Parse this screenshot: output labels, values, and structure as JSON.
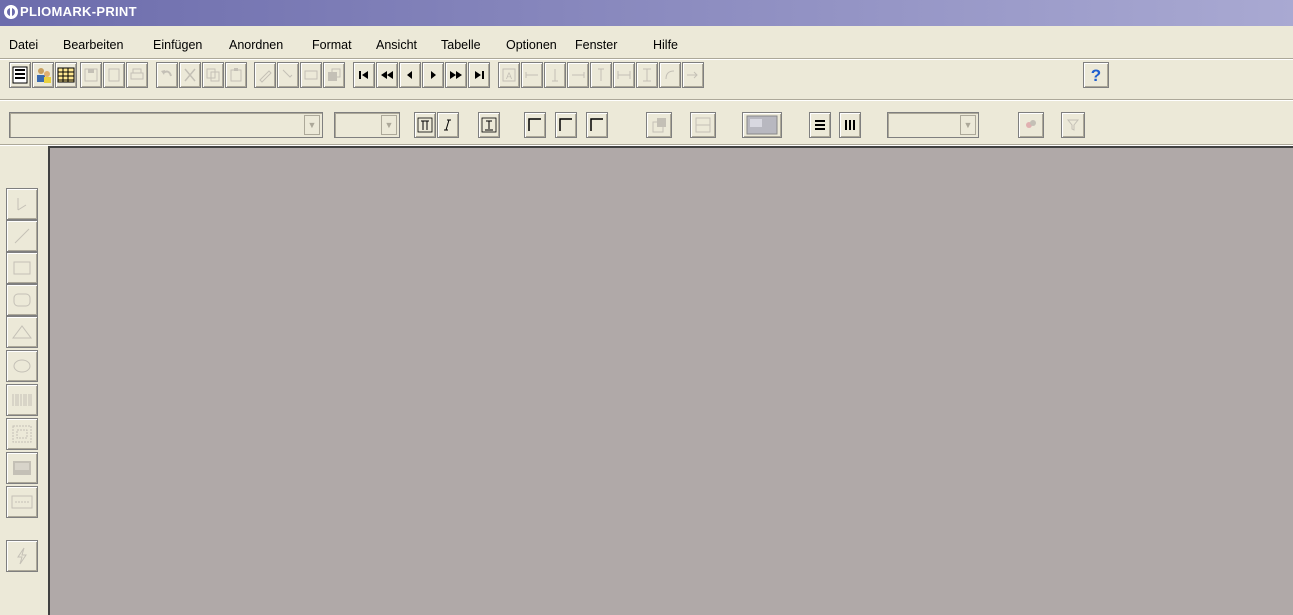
{
  "window": {
    "title": "PLIOMARK-PRINT",
    "title_bg": "#6c6cac",
    "app_icon": "scs-logo-icon"
  },
  "menu": {
    "items": [
      "Datei",
      "Bearbeiten",
      "Einfügen",
      "Anordnen",
      "Format",
      "Ansicht",
      "Tabelle",
      "Optionen",
      "Fenster",
      "Hilfe"
    ]
  },
  "toolbar1": {
    "buttons": [
      {
        "name": "list-view-icon",
        "enabled": true
      },
      {
        "name": "users-icon",
        "enabled": true
      },
      {
        "name": "table-grid-icon",
        "enabled": true
      },
      {
        "name": "save-icon",
        "enabled": false
      },
      {
        "name": "print-preview-icon",
        "enabled": false
      },
      {
        "name": "print-icon",
        "enabled": false
      },
      {
        "name": "undo-icon",
        "enabled": false
      },
      {
        "name": "cut-icon",
        "enabled": false
      },
      {
        "name": "copy-icon",
        "enabled": false
      },
      {
        "name": "paste-icon",
        "enabled": false
      },
      {
        "name": "pen-icon",
        "enabled": false
      },
      {
        "name": "pen-select-icon",
        "enabled": false
      },
      {
        "name": "text-field-icon",
        "enabled": false
      },
      {
        "name": "stack-icon",
        "enabled": false
      },
      {
        "name": "first-record-icon",
        "enabled": true
      },
      {
        "name": "fast-back-icon",
        "enabled": true
      },
      {
        "name": "prev-icon",
        "enabled": true
      },
      {
        "name": "next-icon",
        "enabled": true
      },
      {
        "name": "fast-forward-icon",
        "enabled": true
      },
      {
        "name": "last-record-icon",
        "enabled": true
      },
      {
        "name": "text-frame-icon",
        "enabled": false
      },
      {
        "name": "align-left-edge-icon",
        "enabled": false
      },
      {
        "name": "align-bottom-edge-icon",
        "enabled": false
      },
      {
        "name": "align-right-edge-icon",
        "enabled": false
      },
      {
        "name": "align-top-edge-icon",
        "enabled": false
      },
      {
        "name": "distribute-h-icon",
        "enabled": false
      },
      {
        "name": "distribute-v-icon",
        "enabled": false
      },
      {
        "name": "rotate-icon",
        "enabled": false
      },
      {
        "name": "import-icon",
        "enabled": false
      },
      {
        "name": "help-icon",
        "enabled": true
      }
    ]
  },
  "toolbar2": {
    "font_value": "",
    "size_value": "",
    "style_buttons": [
      "bold-icon",
      "italic-icon",
      "underline-icon"
    ],
    "frame_buttons": [
      "frame-top-left-icon",
      "frame-left-icon",
      "frame-corner-icon"
    ],
    "misc_buttons": [
      "bring-forward-icon",
      "split-horizontal-icon",
      "image-icon"
    ],
    "align_buttons": [
      "align-rows-icon",
      "align-columns-icon"
    ],
    "zoom_value": "",
    "end_buttons": [
      "color-picker-icon",
      "filter-icon"
    ]
  },
  "left_tools": [
    "pointer-icon",
    "line-icon",
    "rectangle-icon",
    "rounded-rect-icon",
    "triangle-icon",
    "ellipse-icon",
    "barcode-icon",
    "matrix-code-icon",
    "image-frame-icon",
    "text-block-icon",
    "lightning-icon"
  ],
  "colors": {
    "workspace": "#b0a9a8",
    "chrome": "#ece9d8",
    "disabled": "#b6b2a6",
    "help_blue": "#1f5fcf"
  }
}
